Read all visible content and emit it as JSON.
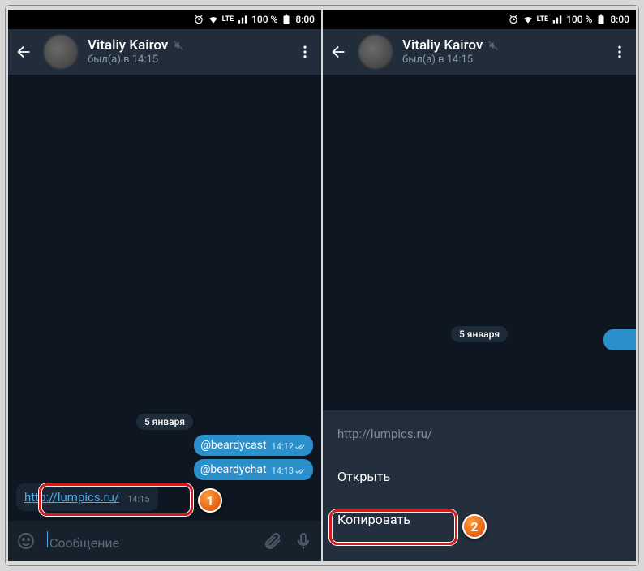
{
  "status": {
    "battery_text": "100 %",
    "time": "8:00"
  },
  "header": {
    "contact_name": "Vitaliy Kairov",
    "subtitle": "был(а) в 14:15"
  },
  "chat": {
    "date_label": "5 января",
    "messages": [
      {
        "text": "@beardycast",
        "time": "14:12"
      },
      {
        "text": "@beardychat",
        "time": "14:13"
      }
    ],
    "link_message": {
      "url": "http://lumpics.ru/",
      "time": "14:15"
    }
  },
  "input": {
    "placeholder": "Сообщение"
  },
  "sheet": {
    "url": "http://lumpics.ru/",
    "open": "Открыть",
    "copy": "Копировать"
  },
  "callouts": {
    "one": "1",
    "two": "2"
  }
}
